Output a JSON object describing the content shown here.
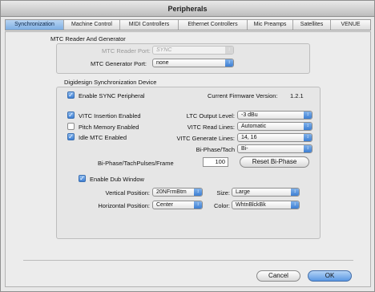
{
  "window": {
    "title": "Peripherals"
  },
  "tabs": [
    {
      "label": "Synchronization",
      "active": true
    },
    {
      "label": "Machine Control",
      "active": false
    },
    {
      "label": "MIDI Controllers",
      "active": false
    },
    {
      "label": "Ethernet Controllers",
      "active": false
    },
    {
      "label": "Mic Preamps",
      "active": false
    },
    {
      "label": "Satellites",
      "active": false
    },
    {
      "label": "VENUE",
      "active": false
    }
  ],
  "mtc": {
    "section_title": "MTC Reader And Generator",
    "reader_label": "MTC Reader Port:",
    "reader_value": "SYNC",
    "generator_label": "MTC Generator Port:",
    "generator_value": "none"
  },
  "sync": {
    "section_title": "Digidesign Synchronization Device",
    "enable_label": "Enable SYNC Peripheral",
    "firmware_label": "Current Firmware Version:",
    "firmware_value": "1.2.1",
    "vitc_insertion_label": "VITC Insertion Enabled",
    "pitch_memory_label": "Pitch Memory Enabled",
    "idle_mtc_label": "Idle MTC Enabled",
    "ltc_output_label": "LTC Output Level:",
    "ltc_output_value": "-3 dBu",
    "vitc_read_label": "VITC Read Lines:",
    "vitc_read_value": "Automatic",
    "vitc_generate_label": "VITC Generate Lines:",
    "vitc_generate_value": "14, 16",
    "biphase_label": "Bi-Phase/Tach",
    "biphase_value": "Bi-",
    "pulses_label": "Bi-Phase/TachPulses/Frame",
    "pulses_value": "100",
    "reset_label": "Reset Bi-Phase",
    "dub_label": "Enable Dub Window",
    "vpos_label": "Vertical Position:",
    "vpos_value": "20NFrmBtm",
    "hpos_label": "Horizontal Position:",
    "hpos_value": "Center",
    "size_label": "Size:",
    "size_value": "Large",
    "color_label": "Color:",
    "color_value": "WhtnBlckBk"
  },
  "buttons": {
    "cancel": "Cancel",
    "ok": "OK"
  },
  "checks": {
    "enable_sync": true,
    "vitc_insertion": true,
    "pitch_memory": false,
    "idle_mtc": true,
    "dub_window": true
  }
}
